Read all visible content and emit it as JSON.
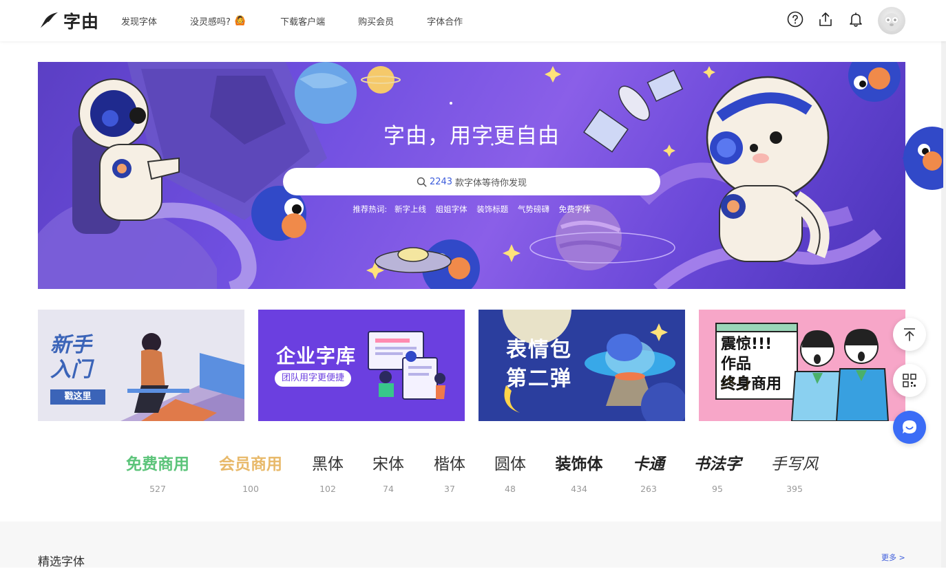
{
  "header": {
    "logo_text": "字由",
    "nav": [
      {
        "label": "发现字体"
      },
      {
        "label": "没灵感吗?",
        "emoji": "🙆"
      },
      {
        "label": "下载客户端"
      },
      {
        "label": "购买会员"
      },
      {
        "label": "字体合作"
      }
    ],
    "icons": [
      "help-icon",
      "upload-icon",
      "bell-icon"
    ]
  },
  "hero": {
    "title": "字由，用字更自由",
    "search_count": "2243",
    "search_text": "款字体等待你发现",
    "hot_label": "推荐热词:",
    "hot_words": [
      "新字上线",
      "姐姐字体",
      "装饰标题",
      "气势磅礴",
      "免费字体"
    ]
  },
  "cards": [
    {
      "title_line1": "新手",
      "title_line2": "入门",
      "button": "戳这里"
    },
    {
      "title": "企业字库",
      "subtitle": "团队用字更便捷"
    },
    {
      "title_line1": "表情包",
      "title_line2": "第二弹"
    },
    {
      "title_line1": "震惊!!!",
      "title_line2": "作品",
      "title_line3a": "终身",
      "title_line3b": "商用"
    }
  ],
  "categories": [
    {
      "name": "免费商用",
      "count": "527",
      "color": "#5cc47a"
    },
    {
      "name": "会员商用",
      "count": "100",
      "color": "#e8b96a"
    },
    {
      "name": "黑体",
      "count": "102",
      "color": "#333333"
    },
    {
      "name": "宋体",
      "count": "74",
      "color": "#333333"
    },
    {
      "name": "楷体",
      "count": "37",
      "color": "#333333"
    },
    {
      "name": "圆体",
      "count": "48",
      "color": "#333333"
    },
    {
      "name": "装饰体",
      "count": "434",
      "color": "#222222"
    },
    {
      "name": "卡通",
      "count": "263",
      "color": "#222222"
    },
    {
      "name": "书法字",
      "count": "95",
      "color": "#222222"
    },
    {
      "name": "手写风",
      "count": "395",
      "color": "#333333"
    }
  ],
  "section": {
    "title": "精选字体",
    "more": "更多 >"
  },
  "floating": [
    "back-to-top-icon",
    "qrcode-icon",
    "chat-icon"
  ]
}
